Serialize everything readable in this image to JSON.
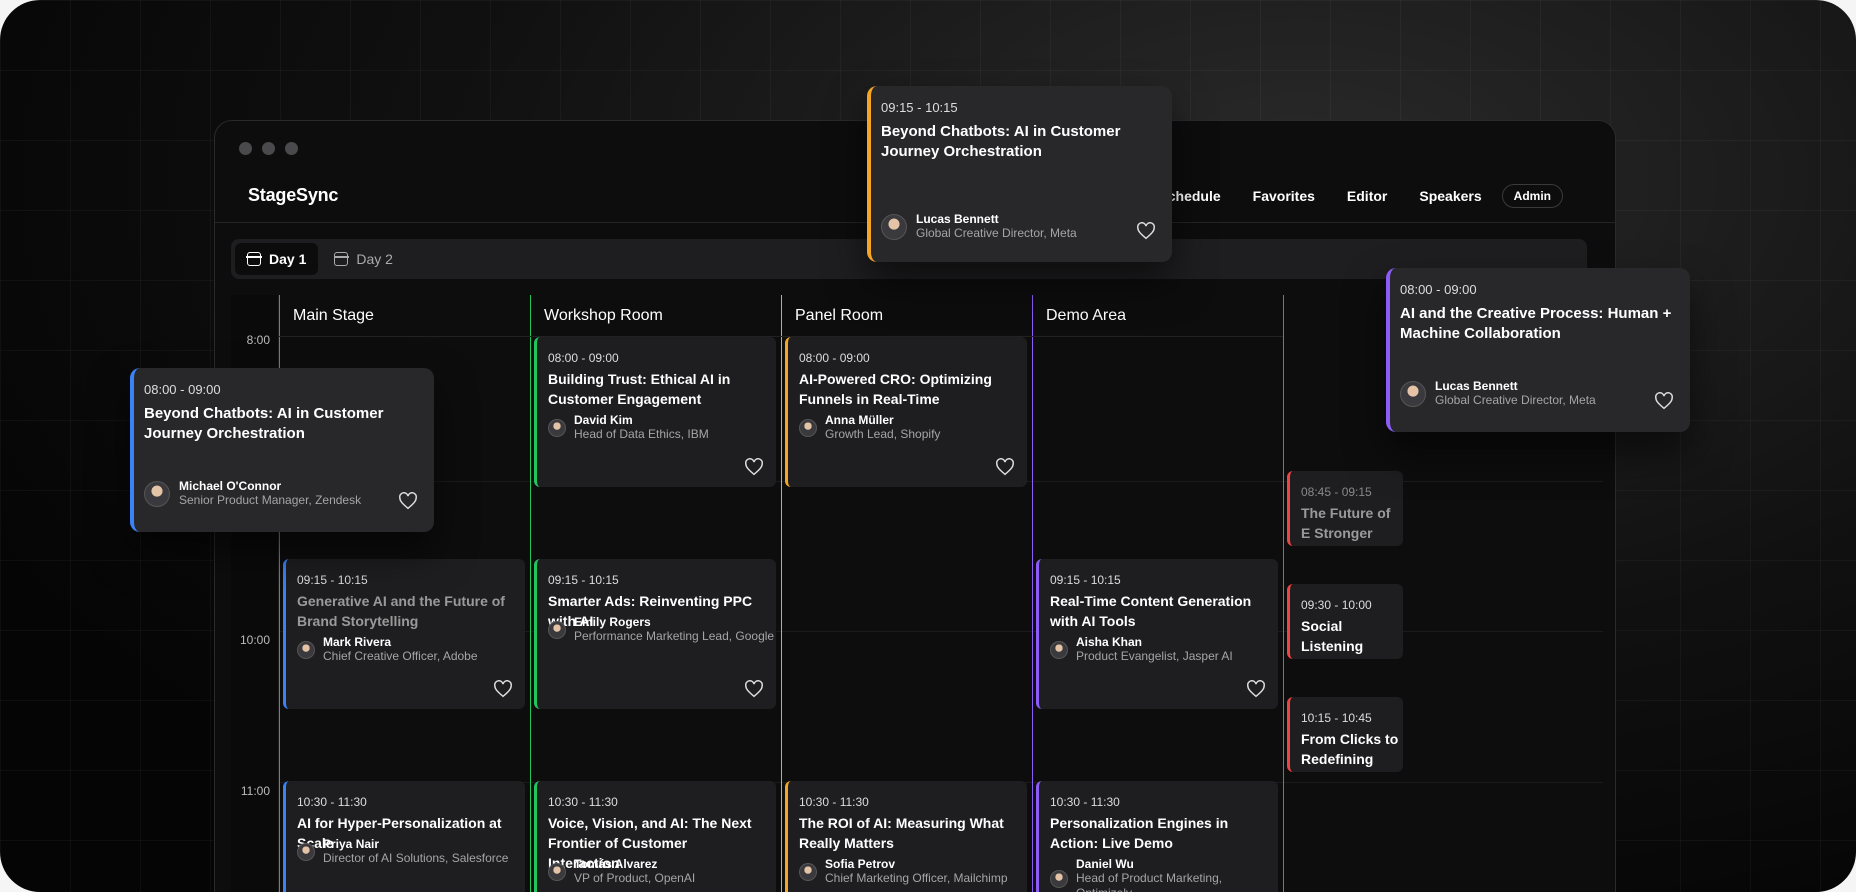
{
  "app": {
    "brand": "StageSync",
    "nav": [
      "Schedule",
      "Favorites",
      "Editor",
      "Speakers"
    ],
    "admin_label": "Admin"
  },
  "days": [
    "Day 1",
    "Day 2"
  ],
  "times": [
    "8:00",
    "10:00",
    "11:00"
  ],
  "columns": [
    {
      "name": "Main Stage",
      "color": "#3b82f6"
    },
    {
      "name": "Workshop Room",
      "color": "#22c55e"
    },
    {
      "name": "Panel Room",
      "color": "#f5a524"
    },
    {
      "name": "Demo Area",
      "color": "#8b5cf6"
    }
  ],
  "sessions": {
    "ws1": {
      "time": "08:00 - 09:00",
      "title": "Building Trust: Ethical AI in Customer Engagement",
      "speaker": "David Kim",
      "role": "Head of Data Ethics, IBM"
    },
    "pr1": {
      "time": "08:00 - 09:00",
      "title": "AI-Powered CRO: Optimizing Funnels in Real-Time",
      "speaker": "Anna Müller",
      "role": "Growth Lead, Shopify"
    },
    "ms2": {
      "time": "09:15 - 10:15",
      "title": "Generative AI and the Future of Brand Storytelling",
      "speaker": "Mark Rivera",
      "role": "Chief Creative Officer, Adobe"
    },
    "ws2": {
      "time": "09:15 - 10:15",
      "title": "Smarter Ads: Reinventing PPC with AI",
      "speaker": "Emily Rogers",
      "role": "Performance Marketing Lead, Google"
    },
    "da2": {
      "time": "09:15 - 10:15",
      "title": "Real-Time Content Generation with AI Tools",
      "speaker": "Aisha Khan",
      "role": "Product Evangelist, Jasper AI"
    },
    "ms3": {
      "time": "10:30 - 11:30",
      "title": "AI for Hyper-Personalization at Scale",
      "speaker": "Priya Nair",
      "role": "Director of AI Solutions, Salesforce"
    },
    "ws3": {
      "time": "10:30 - 11:30",
      "title": "Voice, Vision, and AI: The Next Frontier of Customer Interaction",
      "speaker": "Tomás Alvarez",
      "role": "VP of Product, OpenAI"
    },
    "pr3": {
      "time": "10:30 - 11:30",
      "title": "The ROI of AI: Measuring What Really Matters",
      "speaker": "Sofia Petrov",
      "role": "Chief Marketing Officer, Mailchimp"
    },
    "da3": {
      "time": "10:30 - 11:30",
      "title": "Personalization Engines in Action: Live Demo",
      "speaker": "Daniel Wu",
      "role": "Head of Product Marketing, Optimizely"
    },
    "x1": {
      "time": "08:45 - 09:15",
      "title": "The Future of E Stronger"
    },
    "x2": {
      "time": "09:30 - 10:00",
      "title": "Social Listening Signals"
    },
    "x3": {
      "time": "10:15 - 10:45",
      "title": "From Clicks to Redefining Eng"
    }
  },
  "floating": {
    "left": {
      "time": "08:00 - 09:00",
      "title": "Beyond Chatbots: AI in Customer Journey Orchestration",
      "speaker": "Michael O'Connor",
      "role": "Senior Product Manager, Zendesk",
      "color": "#3b82f6"
    },
    "top": {
      "time": "09:15 - 10:15",
      "title": "Beyond Chatbots: AI in Customer Journey Orchestration",
      "speaker": "Lucas Bennett",
      "role": "Global Creative Director, Meta",
      "color": "#f5a524"
    },
    "right": {
      "time": "08:00 - 09:00",
      "title": "AI and the Creative Process: Human + Machine Collaboration",
      "speaker": "Lucas Bennett",
      "role": "Global Creative Director, Meta",
      "color": "#8b5cf6"
    }
  },
  "extra_color": "#ef4444",
  "icons": [
    "calendar-icon",
    "heart-icon"
  ]
}
